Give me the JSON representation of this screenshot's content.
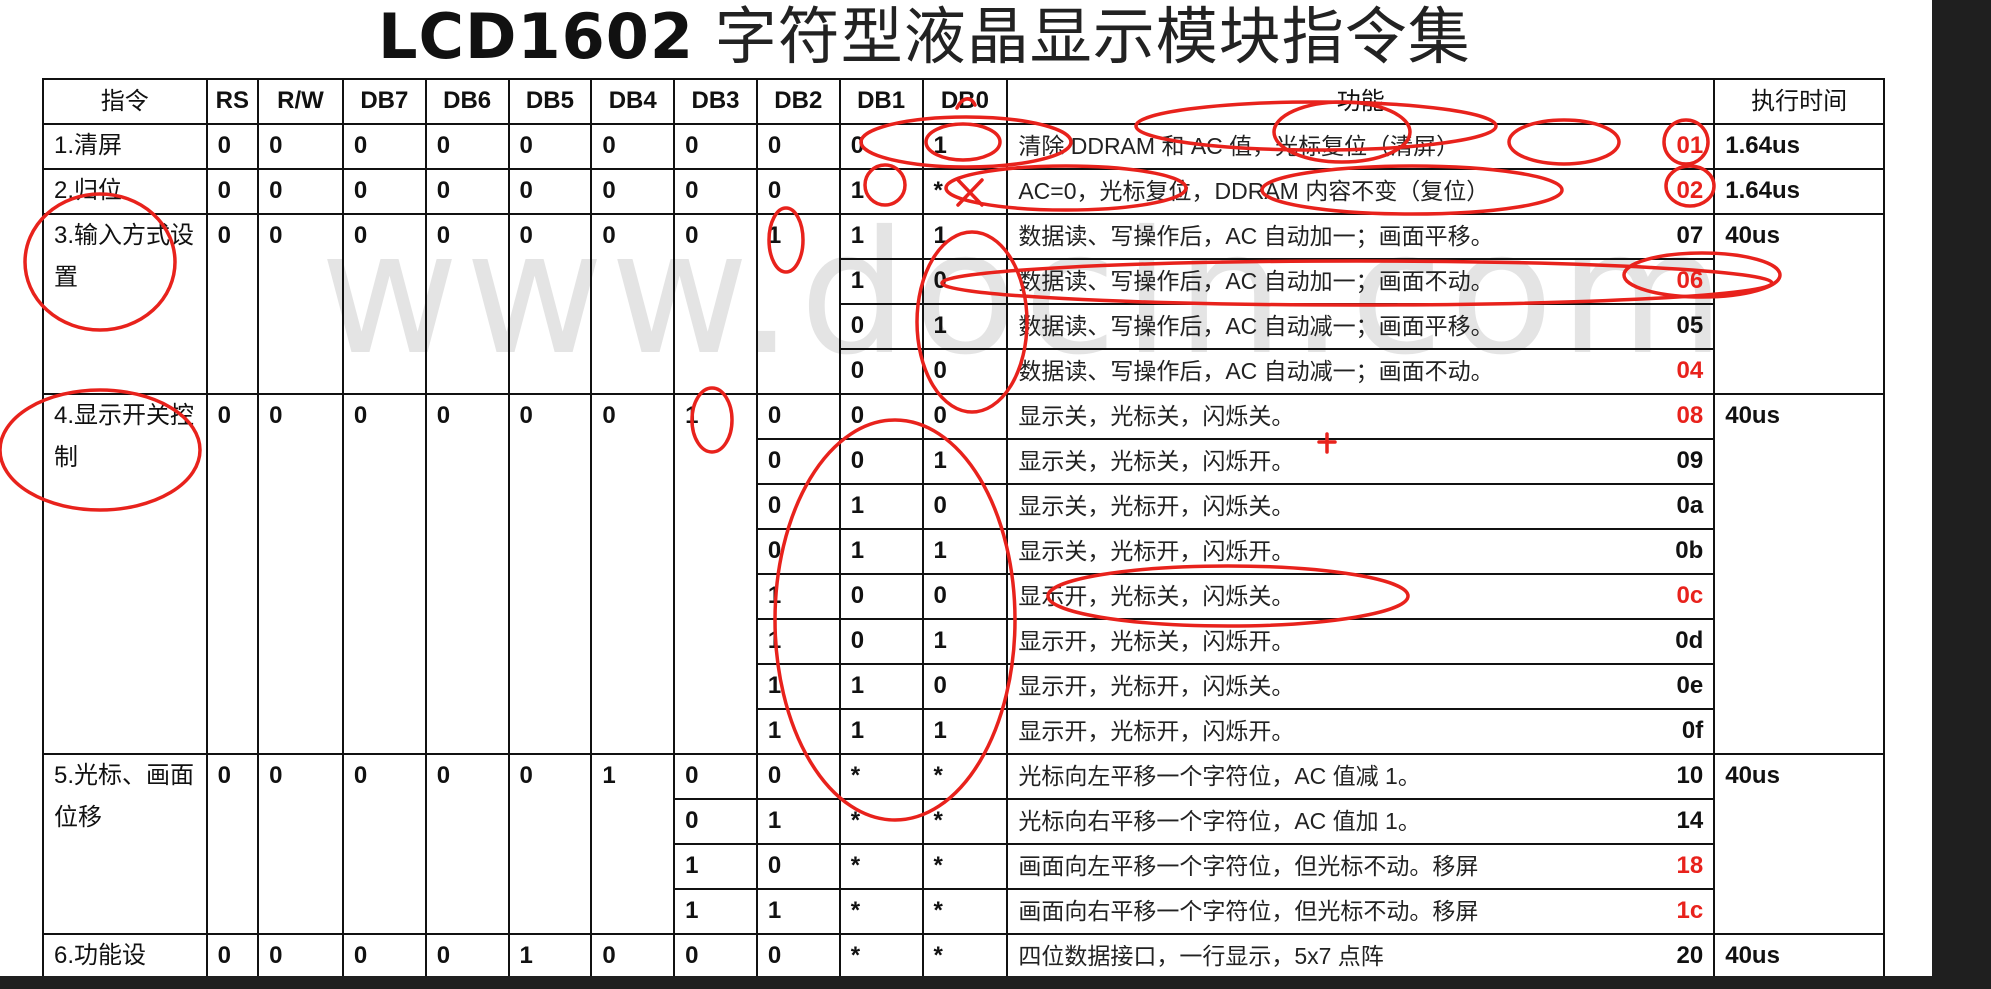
{
  "title": {
    "bold": "LCD1602",
    "rest": "字符型液晶显示模块指令集"
  },
  "watermark": "www.docin.com",
  "headers": [
    "指令",
    "RS",
    "R/W",
    "DB7",
    "DB6",
    "DB5",
    "DB4",
    "DB3",
    "DB2",
    "DB1",
    "DB0",
    "功能",
    "执行时间"
  ],
  "groups": [
    {
      "name": "1.清屏",
      "rs": "0",
      "rw": "0",
      "db7": "0",
      "db6": "0",
      "db5": "0",
      "db4": "0",
      "time": "1.64us",
      "rows": [
        {
          "db3": "0",
          "db2": "0",
          "db1": "0",
          "db0": "1",
          "func": "清除 DDRAM 和 AC 值，光标复位（清屏）",
          "code": "01",
          "code_red": true
        }
      ]
    },
    {
      "name": "2.归位",
      "rs": "0",
      "rw": "0",
      "db7": "0",
      "db6": "0",
      "db5": "0",
      "db4": "0",
      "time": "1.64us",
      "rows": [
        {
          "db3": "0",
          "db2": "0",
          "db1": "1",
          "db0": "*",
          "func": "AC=0，光标复位，DDRAM 内容不变（复位）",
          "code": "02",
          "code_red": true
        }
      ]
    },
    {
      "name": "3.输入方式设置",
      "rs": "0",
      "rw": "0",
      "db7": "0",
      "db6": "0",
      "db5": "0",
      "db4": "0",
      "time": "40us",
      "rows": [
        {
          "db3": "0",
          "db2": "1",
          "db1": "1",
          "db0": "1",
          "func": "数据读、写操作后，AC 自动加一；画面平移。",
          "code": "07",
          "code_red": false
        },
        {
          "db1": "1",
          "db0": "0",
          "func": "数据读、写操作后，AC 自动加一；画面不动。",
          "code": "06",
          "code_red": true
        },
        {
          "db1": "0",
          "db0": "1",
          "func": "数据读、写操作后，AC 自动减一；画面平移。",
          "code": "05",
          "code_red": false
        },
        {
          "db1": "0",
          "db0": "0",
          "func": "数据读、写操作后，AC 自动减一；画面不动。",
          "code": "04",
          "code_red": true
        }
      ]
    },
    {
      "name": "4.显示开关控制",
      "rs": "0",
      "rw": "0",
      "db7": "0",
      "db6": "0",
      "db5": "0",
      "db4": "0",
      "time": "40us",
      "rows": [
        {
          "db3": "1",
          "db2": "0",
          "db1": "0",
          "db0": "0",
          "func": "显示关，光标关，闪烁关。",
          "code": "08",
          "code_red": true
        },
        {
          "db2": "0",
          "db1": "0",
          "db0": "1",
          "func": "显示关，光标关，闪烁开。",
          "code": "09",
          "code_red": false
        },
        {
          "db2": "0",
          "db1": "1",
          "db0": "0",
          "func": "显示关，光标开，闪烁关。",
          "code": "0a",
          "code_red": false
        },
        {
          "db2": "0",
          "db1": "1",
          "db0": "1",
          "func": "显示关，光标开，闪烁开。",
          "code": "0b",
          "code_red": false
        },
        {
          "db2": "1",
          "db1": "0",
          "db0": "0",
          "func": "显示开，光标关，闪烁关。",
          "code": "0c",
          "code_red": true
        },
        {
          "db2": "1",
          "db1": "0",
          "db0": "1",
          "func": "显示开，光标关，闪烁开。",
          "code": "0d",
          "code_red": false
        },
        {
          "db2": "1",
          "db1": "1",
          "db0": "0",
          "func": "显示开，光标开，闪烁关。",
          "code": "0e",
          "code_red": false
        },
        {
          "db2": "1",
          "db1": "1",
          "db0": "1",
          "func": "显示开，光标开，闪烁开。",
          "code": "0f",
          "code_red": false
        }
      ]
    },
    {
      "name": "5.光标、画面位移",
      "rs": "0",
      "rw": "0",
      "db7": "0",
      "db6": "0",
      "db5": "0",
      "db4": "1",
      "time": "40us",
      "rows": [
        {
          "db3": "0",
          "db2": "0",
          "db1": "*",
          "db0": "*",
          "func": "光标向左平移一个字符位，AC 值减 1。",
          "code": "10",
          "code_red": false
        },
        {
          "db3": "0",
          "db2": "1",
          "db1": "*",
          "db0": "*",
          "func": "光标向右平移一个字符位，AC 值加 1。",
          "code": "14",
          "code_red": false
        },
        {
          "db3": "1",
          "db2": "0",
          "db1": "*",
          "db0": "*",
          "func": "画面向左平移一个字符位，但光标不动。移屏",
          "code": "18",
          "code_red": true
        },
        {
          "db3": "1",
          "db2": "1",
          "db1": "*",
          "db0": "*",
          "func": "画面向右平移一个字符位，但光标不动。移屏",
          "code": "1c",
          "code_red": true
        }
      ]
    },
    {
      "name": "6.功能设",
      "rs": "0",
      "rw": "0",
      "db7": "0",
      "db6": "0",
      "db5": "1",
      "db4": "0",
      "time": "40us",
      "rows": [
        {
          "db3": "0",
          "db2": "0",
          "db1": "*",
          "db0": "*",
          "func": "四位数据接口，一行显示，5x7 点阵",
          "code": "20",
          "code_red": false
        }
      ]
    }
  ],
  "colors": {
    "ink": "#e8221c",
    "blue": "#2b4fd9",
    "border": "#111111"
  }
}
